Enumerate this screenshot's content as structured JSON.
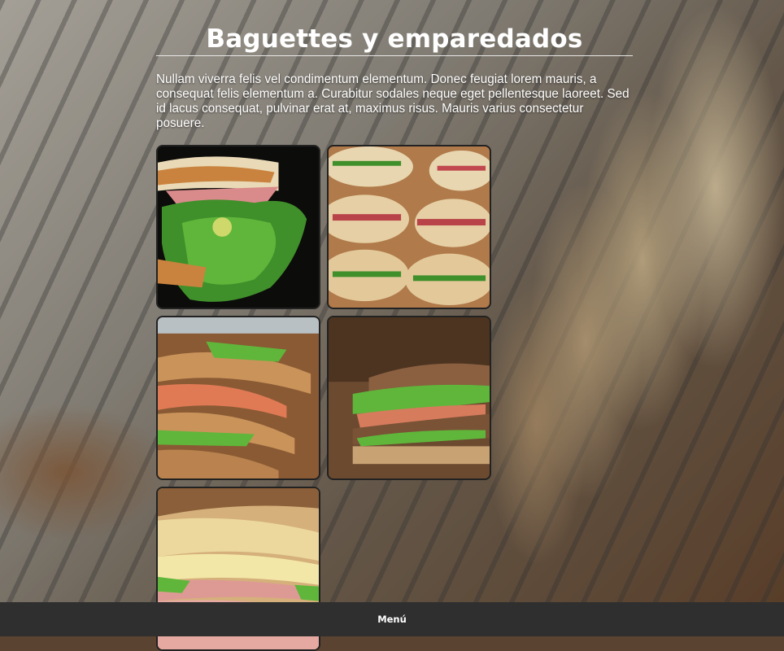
{
  "page": {
    "title": "Baguettes y emparedados",
    "description": "Nullam viverra felis vel condimentum elementum. Donec feugiat lorem mauris, a consequat felis elementum a. Curabitur sodales neque eget pellentesque laoreet. Sed id lacus consequat, pulvinar erat at, maximus risus. Mauris varius consectetur posuere."
  },
  "gallery": {
    "images": [
      {
        "subject": "sandwich-lettuce-ham-dark"
      },
      {
        "subject": "stacked-baguette-sandwiches"
      },
      {
        "subject": "sandwich-platter-salmon"
      },
      {
        "subject": "multigrain-sandwich-on-board"
      },
      {
        "subject": "ham-cheese-baguettes"
      }
    ]
  },
  "footer": {
    "menu_label": "Menú"
  },
  "colors": {
    "footer_bg": "#2f2f2f",
    "tile_border": "#222222",
    "text": "#ffffff"
  }
}
